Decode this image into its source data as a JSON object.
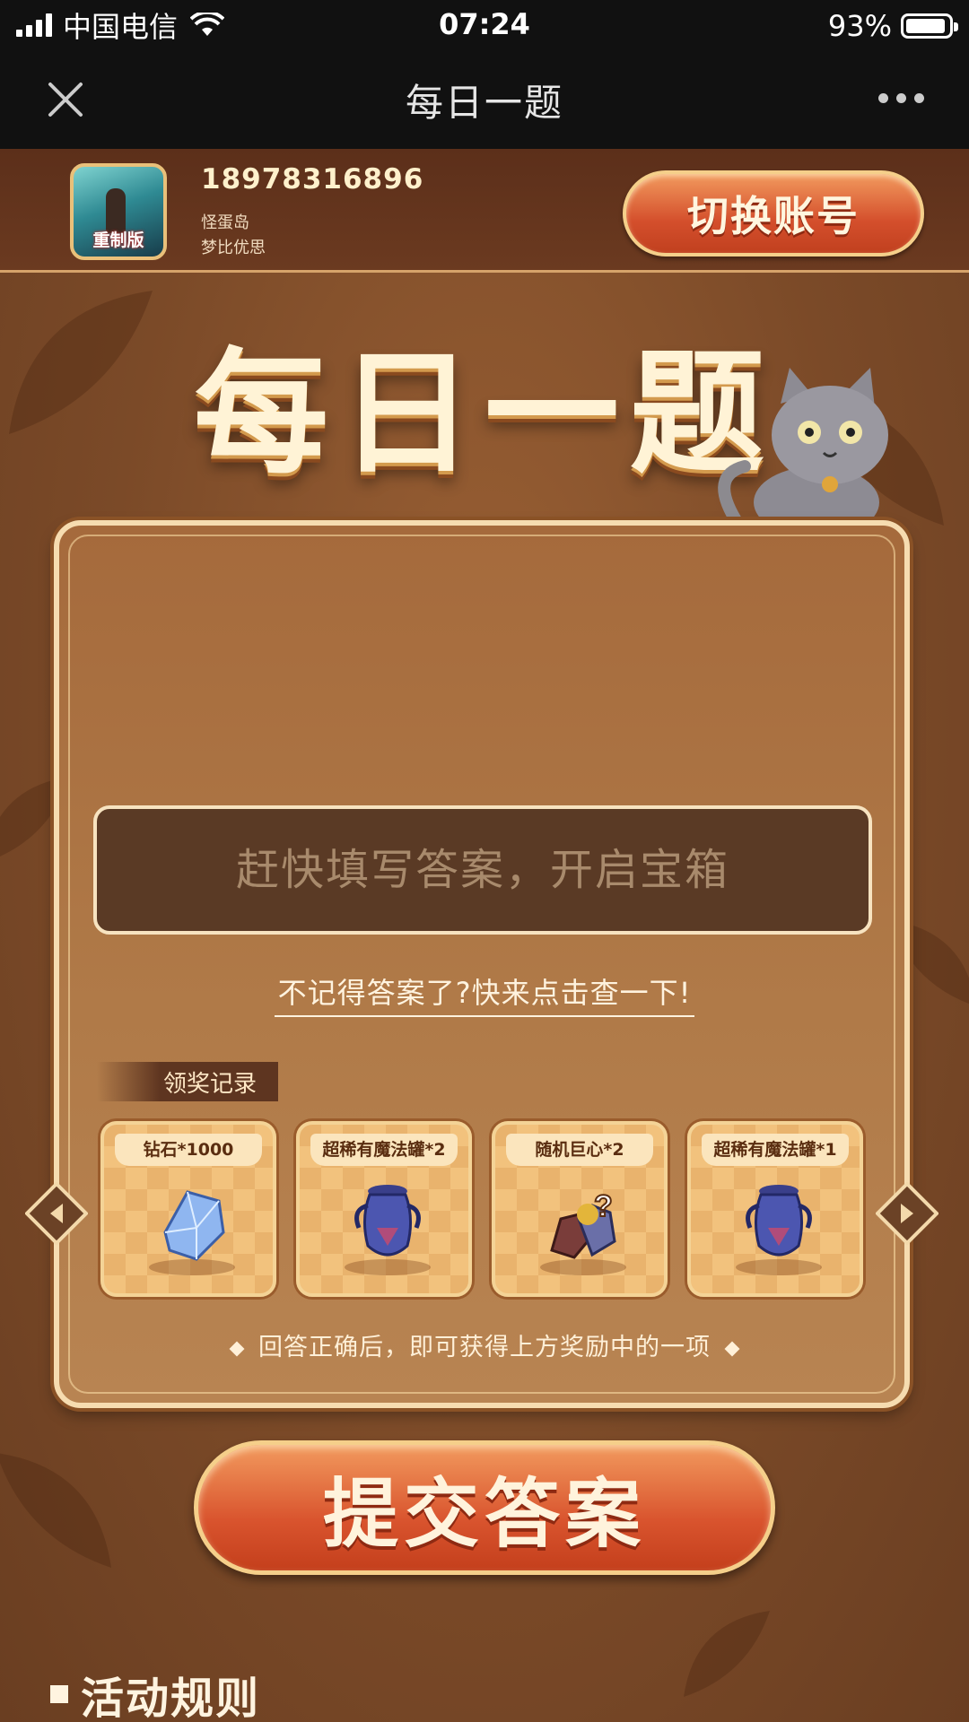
{
  "status_bar": {
    "carrier": "中国电信",
    "time": "07:24",
    "battery": "93%",
    "battery_level": 0.93
  },
  "nav": {
    "title": "每日一题"
  },
  "account": {
    "phone": "18978316896",
    "game": "怪蛋岛",
    "org": "梦比优思",
    "avatar_badge": "重制版",
    "switch_label": "切换账号"
  },
  "page": {
    "title": "每日一题"
  },
  "answer": {
    "placeholder": "赶快填写答案，开启宝箱",
    "value": ""
  },
  "hint_link": "不记得答案了?快来点击查一下!",
  "record_tag": "领奖记录",
  "rewards": [
    {
      "label": "钻石*1000",
      "icon": "diamond-crystal-icon"
    },
    {
      "label": "超稀有魔法罐*2",
      "icon": "magic-jar-icon"
    },
    {
      "label": "随机巨心*2",
      "icon": "random-giant-heart-icon"
    },
    {
      "label": "超稀有魔法罐*1",
      "icon": "magic-jar-icon"
    }
  ],
  "reward_note": "回答正确后，即可获得上方奖励中的一项",
  "submit_label": "提交答案",
  "rules_title": "活动规则",
  "colors": {
    "accent": "#d44f2c",
    "card": "#b07a48",
    "background": "#7a4a2a"
  }
}
